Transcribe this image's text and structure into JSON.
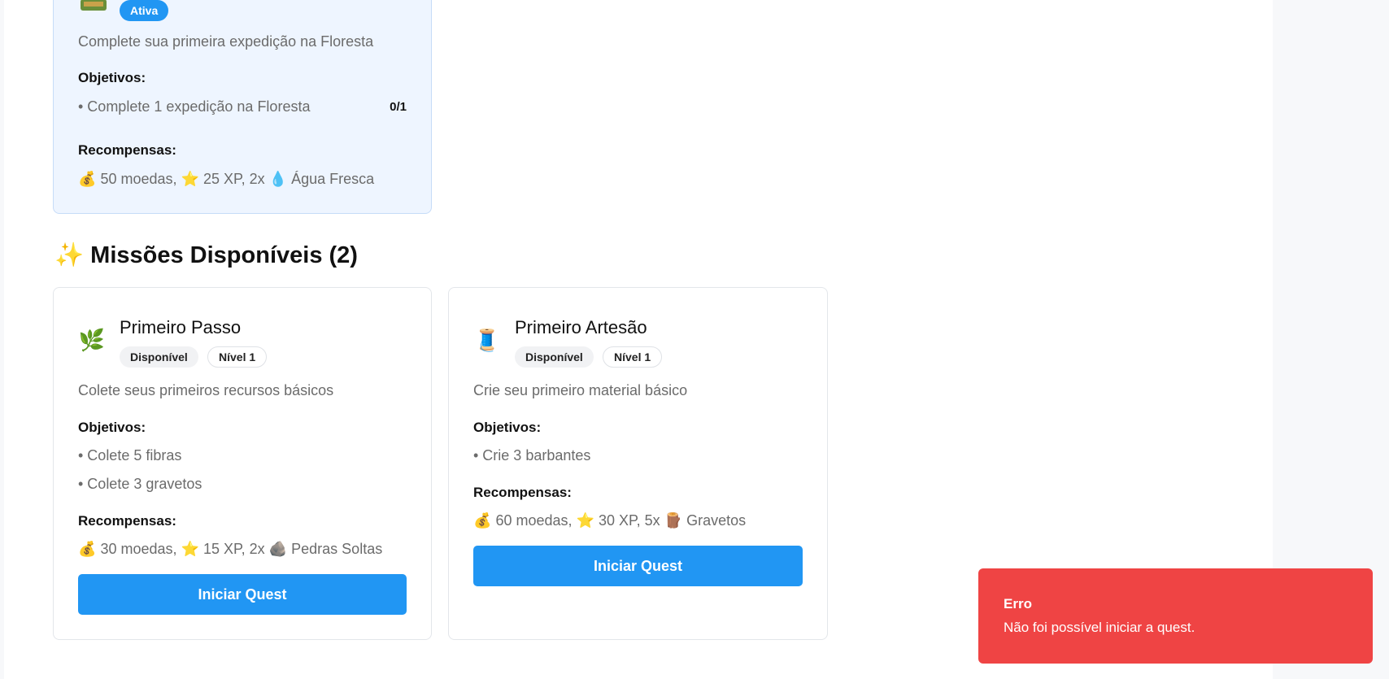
{
  "active_quest": {
    "status_badge": "Ativa",
    "description": "Complete sua primeira expedição na Floresta",
    "objectives_label": "Objetivos:",
    "objectives": [
      {
        "text": "• Complete 1 expedição na Floresta",
        "progress": "0/1"
      }
    ],
    "rewards_label": "Recompensas:",
    "rewards": [
      {
        "icon": "💰",
        "text": "50 moedas,"
      },
      {
        "icon": "⭐",
        "text": "25 XP, 2x"
      },
      {
        "icon": "💧",
        "text": "Água Fresca"
      }
    ]
  },
  "available": {
    "title_icon": "✨",
    "title": "Missões Disponíveis (2)",
    "quests": [
      {
        "icon": "🌿",
        "title": "Primeiro Passo",
        "status": "Disponível",
        "level": "Nível 1",
        "description": "Colete seus primeiros recursos básicos",
        "objectives_label": "Objetivos:",
        "objectives": [
          "• Colete 5 fibras",
          "• Colete 3 gravetos"
        ],
        "rewards_label": "Recompensas:",
        "rewards": [
          {
            "icon": "💰",
            "text": "30 moedas,"
          },
          {
            "icon": "⭐",
            "text": "15 XP, 2x"
          },
          {
            "icon": "🪨",
            "text": "Pedras Soltas"
          }
        ],
        "button": "Iniciar Quest"
      },
      {
        "icon": "🧵",
        "title": "Primeiro Artesão",
        "status": "Disponível",
        "level": "Nível 1",
        "description": "Crie seu primeiro material básico",
        "objectives_label": "Objetivos:",
        "objectives": [
          "• Crie 3 barbantes"
        ],
        "rewards_label": "Recompensas:",
        "rewards": [
          {
            "icon": "💰",
            "text": "60 moedas,"
          },
          {
            "icon": "⭐",
            "text": "30 XP, 5x"
          },
          {
            "icon": "🪵",
            "text": "Gravetos"
          }
        ],
        "button": "Iniciar Quest"
      }
    ]
  },
  "toast": {
    "title": "Erro",
    "message": "Não foi possível iniciar a quest."
  },
  "colors": {
    "accent": "#2196f3",
    "error": "#ef4444"
  }
}
